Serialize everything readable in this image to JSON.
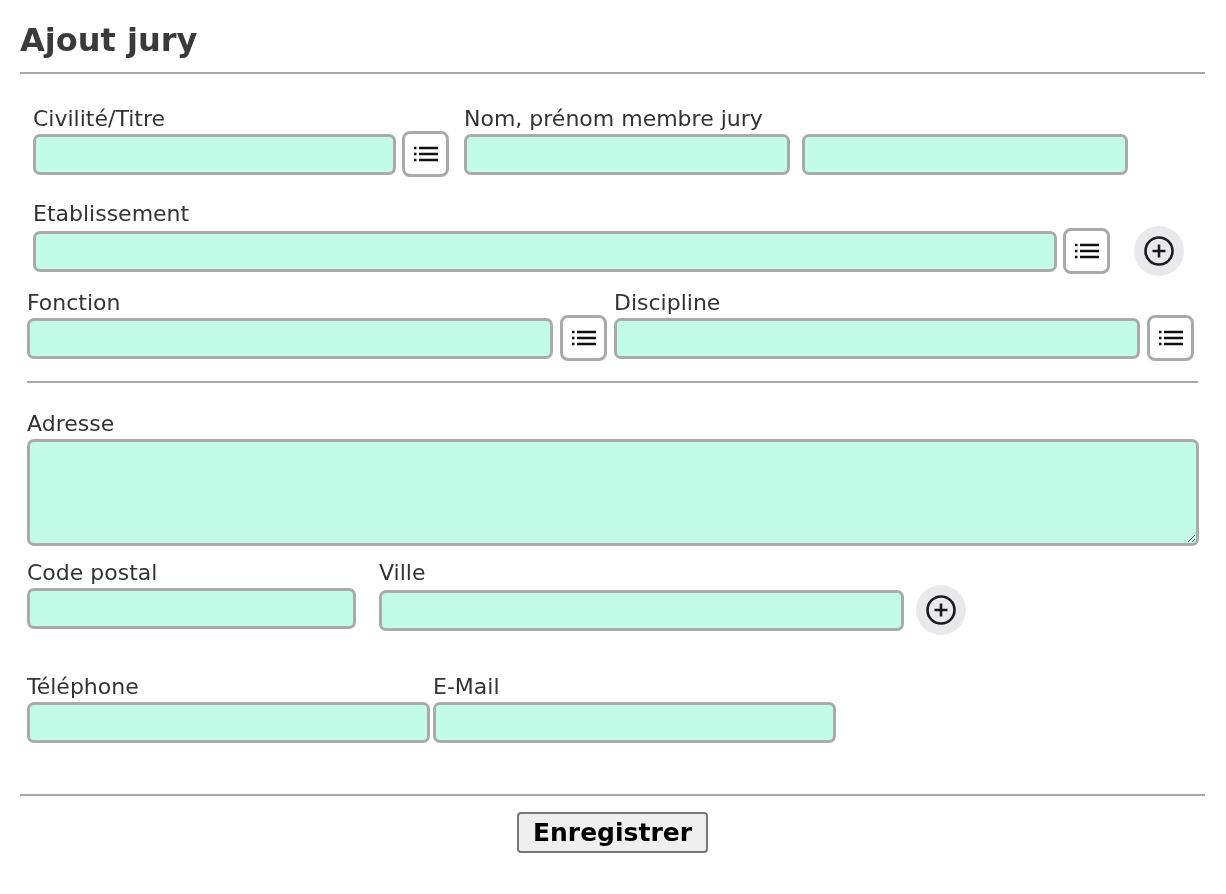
{
  "title": "Ajout jury",
  "sections": [
    {
      "rows": [
        {
          "groups": [
            {
              "label": "Civilité/Titre",
              "controls": [
                {
                  "kind": "input"
                },
                {
                  "kind": "list"
                }
              ]
            },
            {
              "label": "Nom, prénom membre jury",
              "controls": [
                {
                  "kind": "input"
                },
                {
                  "kind": "input"
                }
              ]
            }
          ]
        },
        {
          "groups": [
            {
              "label": "Etablissement",
              "controls": [
                {
                  "kind": "input"
                },
                {
                  "kind": "list"
                },
                {
                  "kind": "add"
                }
              ]
            }
          ]
        },
        {
          "groups": [
            {
              "label": "Fonction",
              "controls": [
                {
                  "kind": "input"
                },
                {
                  "kind": "list"
                }
              ]
            },
            {
              "label": "Discipline",
              "controls": [
                {
                  "kind": "input"
                },
                {
                  "kind": "list"
                }
              ]
            }
          ]
        }
      ]
    },
    {
      "rows": [
        {
          "groups": [
            {
              "label": "Adresse",
              "controls": [
                {
                  "kind": "textarea"
                }
              ]
            }
          ]
        },
        {
          "groups": [
            {
              "label": "Code postal",
              "controls": [
                {
                  "kind": "input"
                }
              ]
            },
            {
              "label": "Ville",
              "controls": [
                {
                  "kind": "input"
                },
                {
                  "kind": "add"
                }
              ]
            }
          ]
        },
        {
          "groups": [
            {
              "label": "Téléphone",
              "controls": [
                {
                  "kind": "input"
                }
              ]
            },
            {
              "label": "E-Mail",
              "controls": [
                {
                  "kind": "input"
                }
              ]
            }
          ]
        }
      ]
    }
  ],
  "submit_button": "Enregistrer"
}
